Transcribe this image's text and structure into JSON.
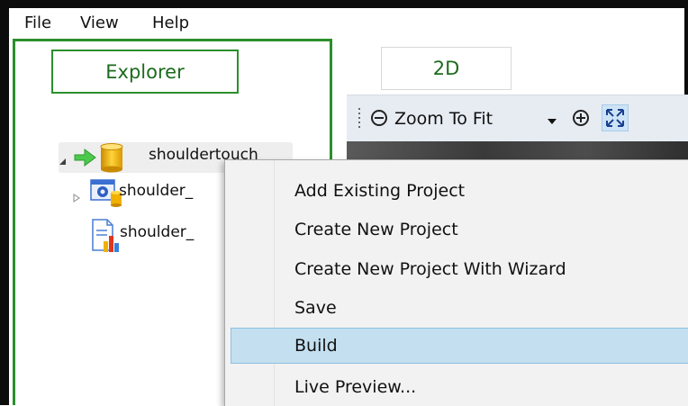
{
  "menubar": {
    "file": "File",
    "view": "View",
    "help": "Help"
  },
  "explorer": {
    "title": "Explorer",
    "tree": {
      "root_label": "shouldertouch",
      "children": [
        {
          "label": "shoulder_"
        },
        {
          "label": "shoulder_"
        }
      ]
    }
  },
  "view_tab": {
    "label": "2D"
  },
  "toolbar": {
    "zoom_value": "Zoom To Fit"
  },
  "context_menu": {
    "items": [
      {
        "label": "Add Existing Project"
      },
      {
        "label": "Create New Project"
      },
      {
        "label": "Create New Project With Wizard"
      },
      {
        "label": "Save"
      },
      {
        "label": "Build",
        "highlighted": true
      },
      {
        "label": "Live Preview..."
      }
    ]
  },
  "colors": {
    "accent_green": "#2b8f2b",
    "menu_highlight": "#c4e0f0"
  },
  "icons": [
    "green-arrow-icon",
    "database-icon",
    "gear-project-icon",
    "chart-document-icon",
    "zoom-out-icon",
    "zoom-in-icon",
    "fit-to-screen-icon"
  ]
}
